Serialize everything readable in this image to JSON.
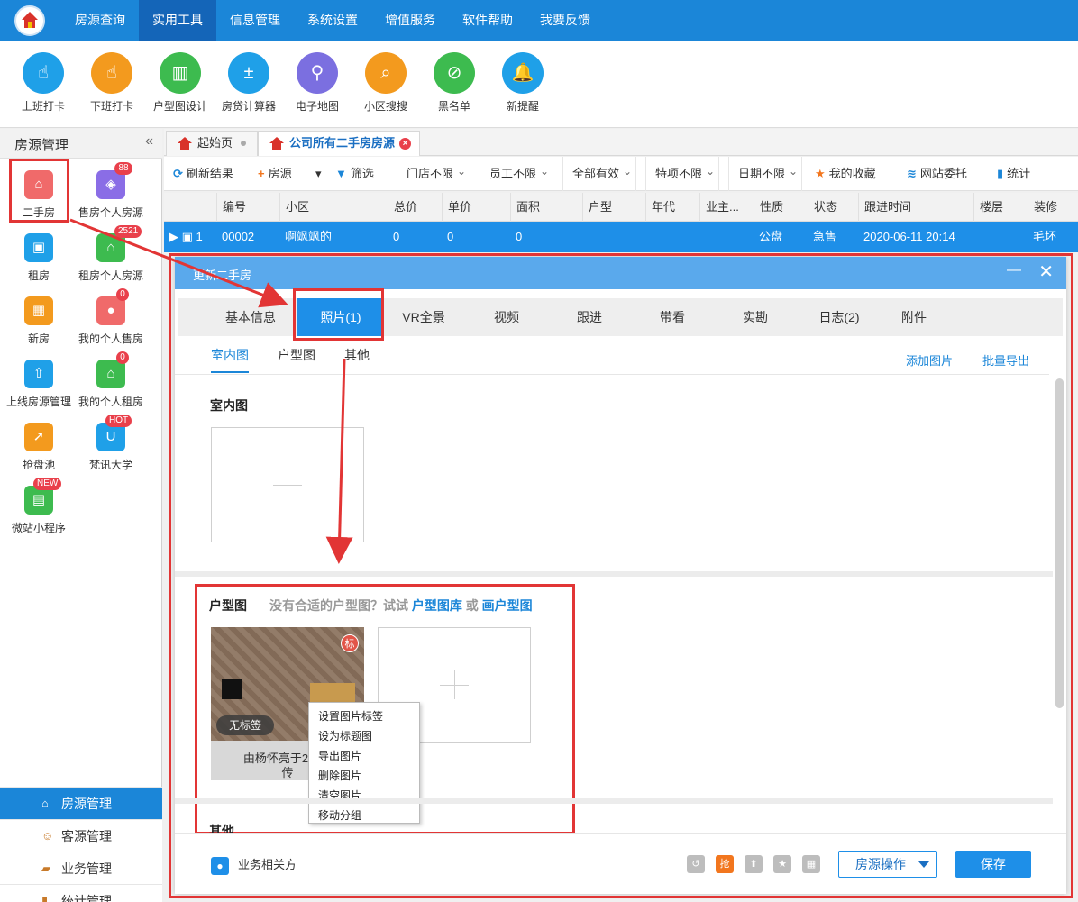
{
  "topbar": {
    "menu": [
      "房源查询",
      "实用工具",
      "信息管理",
      "系统设置",
      "增值服务",
      "软件帮助",
      "我要反馈"
    ],
    "active_index": 1,
    "brand_color": "#1b86d8"
  },
  "toolbar": {
    "tools": [
      {
        "label": "上班打卡",
        "icon": "hand-tap-icon",
        "color": "#1fa0e8"
      },
      {
        "label": "下班打卡",
        "icon": "hand-tap-icon",
        "color": "#f39a1e"
      },
      {
        "label": "户型图设计",
        "icon": "floorplan-icon",
        "color": "#3dbb4f"
      },
      {
        "label": "房贷计算器",
        "icon": "calculator-icon",
        "color": "#1fa0e8"
      },
      {
        "label": "电子地图",
        "icon": "map-pin-icon",
        "color": "#7b6fe0"
      },
      {
        "label": "小区搜搜",
        "icon": "search-icon",
        "color": "#f39a1e"
      },
      {
        "label": "黑名单",
        "icon": "blacklist-icon",
        "color": "#3dbb4f"
      },
      {
        "label": "新提醒",
        "icon": "bell-icon",
        "color": "#1fa0e8"
      }
    ]
  },
  "sidebar": {
    "title": "房源管理",
    "collapse_glyph": "«",
    "items": [
      {
        "label": "二手房",
        "icon": "house-icon",
        "color": "#f06a6a",
        "badge": ""
      },
      {
        "label": "售房个人房源",
        "icon": "tag-icon",
        "color": "#8a6de6",
        "badge": "88"
      },
      {
        "label": "租房",
        "icon": "suitcase-icon",
        "color": "#1fa0e8",
        "badge": ""
      },
      {
        "label": "租房个人房源",
        "icon": "house-key-icon",
        "color": "#3dbb4f",
        "badge": "2521"
      },
      {
        "label": "新房",
        "icon": "building-icon",
        "color": "#f39a1e",
        "badge": ""
      },
      {
        "label": "我的个人售房",
        "icon": "person-icon",
        "color": "#f06a6a",
        "badge": "0"
      },
      {
        "label": "上线房源管理",
        "icon": "upload-icon",
        "color": "#1fa0e8",
        "badge": ""
      },
      {
        "label": "我的个人租房",
        "icon": "house-person-icon",
        "color": "#3dbb4f",
        "badge": "0"
      },
      {
        "label": "抢盘池",
        "icon": "cursor-click-icon",
        "color": "#f39a1e",
        "badge": ""
      },
      {
        "label": "梵讯大学",
        "icon": "university-icon",
        "color": "#1fa0e8",
        "badge": "HOT"
      },
      {
        "label": "微站小程序",
        "icon": "shop-icon",
        "color": "#3dbb4f",
        "badge": "NEW"
      }
    ],
    "nav": [
      {
        "label": "房源管理",
        "icon": "house-icon",
        "active": true
      },
      {
        "label": "客源管理",
        "icon": "people-icon",
        "active": false
      },
      {
        "label": "业务管理",
        "icon": "briefcase-icon",
        "active": false
      },
      {
        "label": "统计管理",
        "icon": "bar-chart-icon",
        "active": false
      }
    ]
  },
  "tabs": [
    {
      "label": "起始页",
      "closable": false
    },
    {
      "label": "公司所有二手房房源",
      "closable": true
    }
  ],
  "actions": [
    {
      "label": "刷新结果",
      "icon": "refresh-icon",
      "glyph": "⟳",
      "color": "#1b86d8"
    },
    {
      "label": "房源",
      "icon": "plus-icon",
      "glyph": "+",
      "color": "#f2761e"
    },
    {
      "label": "▾",
      "icon": "",
      "glyph": "",
      "color": "#333"
    },
    {
      "label": "筛选",
      "icon": "filter-icon",
      "glyph": "▼",
      "color": "#1b86d8"
    },
    {
      "label": "门店不限",
      "dropdown": true
    },
    {
      "label": "员工不限",
      "dropdown": true
    },
    {
      "label": "全部有效",
      "dropdown": true
    },
    {
      "label": "特项不限",
      "dropdown": true
    },
    {
      "label": "日期不限",
      "dropdown": true
    },
    {
      "label": "我的收藏",
      "icon": "star-icon",
      "glyph": "★",
      "color": "#f2761e"
    },
    {
      "label": "网站委托",
      "icon": "stack-icon",
      "glyph": "≋",
      "color": "#1b86d8"
    },
    {
      "label": "统计",
      "icon": "bar-chart-icon",
      "glyph": "▮",
      "color": "#1b86d8"
    }
  ],
  "grid": {
    "columns": [
      "编号",
      "小区",
      "总价",
      "单价",
      "面积",
      "户型",
      "年代",
      "业主...",
      "性质",
      "状态",
      "跟进时间",
      "楼层",
      "装修"
    ],
    "row": {
      "index": "1",
      "cells": [
        "00002",
        "啊飒飒的",
        "0",
        "0",
        "0",
        "",
        "",
        "",
        "公盘",
        "急售",
        "2020-06-11 20:14",
        "",
        "毛坯"
      ]
    }
  },
  "dialog": {
    "title": "更新二手房",
    "minimize": "—",
    "close": "✕",
    "tabs": [
      "基本信息",
      "照片(1)",
      "VR全景",
      "视频",
      "跟进",
      "带看",
      "实勘",
      "日志(2)",
      "附件"
    ],
    "active_tab": 1,
    "subtabs": [
      "室内图",
      "户型图",
      "其他"
    ],
    "links": {
      "add": "添加图片",
      "export": "批量导出"
    },
    "section_indoor": "室内图",
    "section_floorplan": "户型图",
    "fp_hint_pre": "没有合适的户型图？试试",
    "fp_hint_lib": "户型图库",
    "fp_hint_or": "或",
    "fp_hint_draw": "画户型图",
    "photo": {
      "tag_mark": "标",
      "no_tag": "无标签",
      "caption_line1": "由杨怀亮于2020-",
      "caption_line2": "传"
    },
    "context_menu": [
      "设置图片标签",
      "设为标题图",
      "导出图片",
      "删除图片",
      "清空图片",
      "移动分组"
    ],
    "section_other": "其他",
    "footer": {
      "related": "业务相关方",
      "small_icons": [
        {
          "icon": "link-icon",
          "glyph": "↺",
          "color": "#bdbdbd"
        },
        {
          "icon": "grab-icon",
          "glyph": "抢",
          "color": "#f2761e"
        },
        {
          "icon": "top-icon",
          "glyph": "⬆",
          "color": "#bdbdbd"
        },
        {
          "icon": "star-icon",
          "glyph": "★",
          "color": "#bdbdbd"
        },
        {
          "icon": "calculator-icon",
          "glyph": "▦",
          "color": "#bdbdbd"
        }
      ],
      "ops": "房源操作",
      "save": "保存"
    }
  }
}
